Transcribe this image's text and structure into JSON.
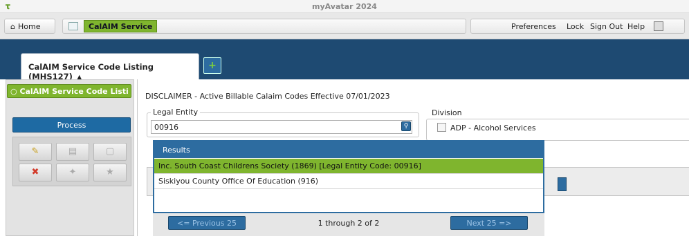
{
  "window": {
    "title": "myAvatar 2024"
  },
  "navbar": {
    "home_label": "Home",
    "active_module": "CalAIM Service",
    "preferences": "Preferences",
    "lock": "Lock",
    "sign_out": "Sign Out",
    "help": "Help"
  },
  "tabs": [
    {
      "label": "CalAIM Service Code Listing (MHS127)"
    }
  ],
  "left_panel": {
    "form_tab": "CalAIM Service Code Listi",
    "process_label": "Process",
    "tool_icons": [
      "note-add-icon",
      "bookmark-icon",
      "sticky-note-icon",
      "cancel-icon",
      "puzzle-icon",
      "star-icon"
    ]
  },
  "form": {
    "disclaimer": "DISCLAIMER - Active Billable Calaim Codes Effective 07/01/2023",
    "legal_entity_label": "Legal Entity",
    "legal_entity_value": "00916",
    "division_label": "Division",
    "division_options": [
      {
        "label": "ADP - Alcohol Services",
        "checked": false
      }
    ]
  },
  "results": {
    "header": "Results",
    "rows": [
      {
        "text": "Inc. South Coast Childrens Society (1869) [Legal Entity Code: 00916]",
        "selected": true
      },
      {
        "text": "Siskiyou County Office Of Education (916)",
        "selected": false
      }
    ],
    "prev_label": "<= Previous 25",
    "count_label": "1 through 2 of 2",
    "next_label": "Next 25 =>"
  },
  "colors": {
    "accent_green": "#7fb52e",
    "header_blue": "#1e4a72",
    "button_blue": "#2d6ca0"
  }
}
